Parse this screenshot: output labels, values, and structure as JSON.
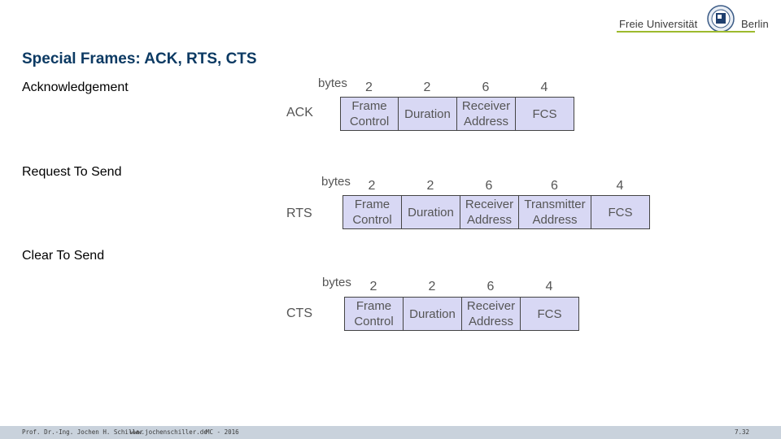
{
  "header": {
    "logo": {
      "left_text": "Freie Universität",
      "right_text": "Berlin",
      "accent_color": "#9dba2d"
    },
    "title": "Special Frames: ACK, RTS, CTS"
  },
  "sections": {
    "ack": "Acknowledgement",
    "rts": "Request To Send",
    "cts": "Clear To Send"
  },
  "frames": {
    "ack": {
      "type": "ACK",
      "bytes_label": "bytes",
      "fields": [
        {
          "size": "2",
          "label": "Frame\nControl"
        },
        {
          "size": "2",
          "label": "Duration"
        },
        {
          "size": "6",
          "label": "Receiver\nAddress"
        },
        {
          "size": "4",
          "label": "FCS"
        }
      ]
    },
    "rts": {
      "type": "RTS",
      "bytes_label": "bytes",
      "fields": [
        {
          "size": "2",
          "label": "Frame\nControl"
        },
        {
          "size": "2",
          "label": "Duration"
        },
        {
          "size": "6",
          "label": "Receiver\nAddress"
        },
        {
          "size": "6",
          "label": "Transmitter\nAddress"
        },
        {
          "size": "4",
          "label": "FCS"
        }
      ]
    },
    "cts": {
      "type": "CTS",
      "bytes_label": "bytes",
      "fields": [
        {
          "size": "2",
          "label": "Frame\nControl"
        },
        {
          "size": "2",
          "label": "Duration"
        },
        {
          "size": "6",
          "label": "Receiver\nAddress"
        },
        {
          "size": "4",
          "label": "FCS"
        }
      ]
    }
  },
  "colors": {
    "title": "#0c3a63",
    "field_fill": "#d8d8f4",
    "footer_bg": "#c9d2dc"
  },
  "footer": {
    "author": "Prof. Dr.-Ing. Jochen H. Schiller",
    "website": "www.jochenschiller.de",
    "course": "MC - 2016",
    "page": "7.32"
  }
}
